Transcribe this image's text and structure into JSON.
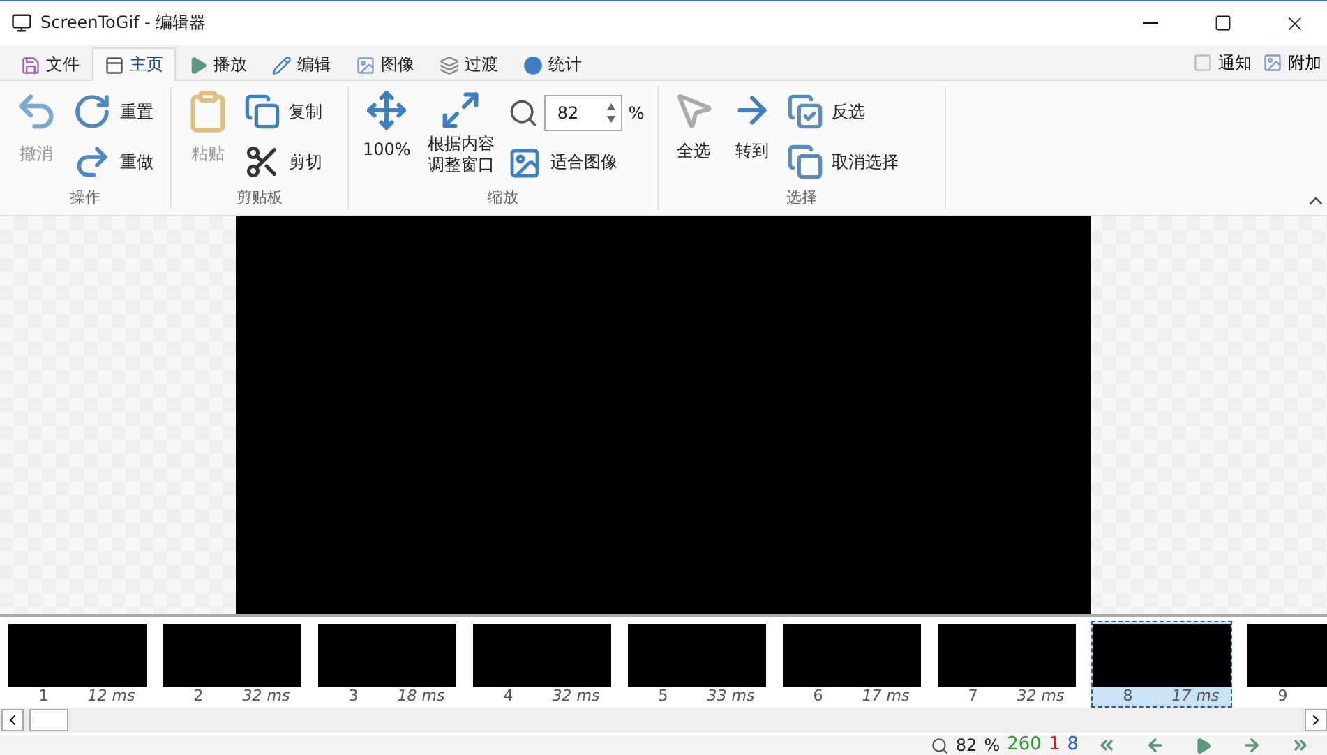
{
  "window": {
    "title": "ScreenToGif - 编辑器"
  },
  "tabs": [
    {
      "label": "文件",
      "selected": false
    },
    {
      "label": "主页",
      "selected": true
    },
    {
      "label": "播放",
      "selected": false
    },
    {
      "label": "编辑",
      "selected": false
    },
    {
      "label": "图像",
      "selected": false
    },
    {
      "label": "过渡",
      "selected": false
    },
    {
      "label": "统计",
      "selected": false
    }
  ],
  "right_tabs": [
    {
      "label": "通知"
    },
    {
      "label": "附加"
    }
  ],
  "ribbon": {
    "actions": {
      "title": "操作",
      "items": [
        {
          "label": "撤消",
          "disabled": true
        },
        {
          "label": "重置",
          "disabled": false
        },
        {
          "label": "重做",
          "disabled": false
        }
      ]
    },
    "clipboard": {
      "title": "剪贴板",
      "items": [
        {
          "label": "粘贴",
          "disabled": true
        },
        {
          "label": "复制",
          "disabled": false
        },
        {
          "label": "剪切",
          "disabled": false
        }
      ]
    },
    "zoom": {
      "title": "缩放",
      "items": [
        {
          "label": "100%"
        },
        {
          "label": "根据内容调整窗口"
        },
        {
          "label": "适合图像"
        }
      ],
      "zoom_value": "82",
      "unit": "%"
    },
    "selection": {
      "title": "选择",
      "items": [
        {
          "label": "全选"
        },
        {
          "label": "转到"
        },
        {
          "label": "反选"
        },
        {
          "label": "取消选择"
        }
      ]
    }
  },
  "frames": [
    {
      "number": "1",
      "duration": "12 ms",
      "selected": false
    },
    {
      "number": "2",
      "duration": "32 ms",
      "selected": false
    },
    {
      "number": "3",
      "duration": "18 ms",
      "selected": false
    },
    {
      "number": "4",
      "duration": "32 ms",
      "selected": false
    },
    {
      "number": "5",
      "duration": "33 ms",
      "selected": false
    },
    {
      "number": "6",
      "duration": "17 ms",
      "selected": false
    },
    {
      "number": "7",
      "duration": "32 ms",
      "selected": false
    },
    {
      "number": "8",
      "duration": "17 ms",
      "selected": true
    },
    {
      "number": "9",
      "selected": false
    }
  ],
  "status_bar": {
    "zoom": "82",
    "unit": "%",
    "frame_count": "260",
    "selected_count": "1",
    "current_frame": "8"
  }
}
